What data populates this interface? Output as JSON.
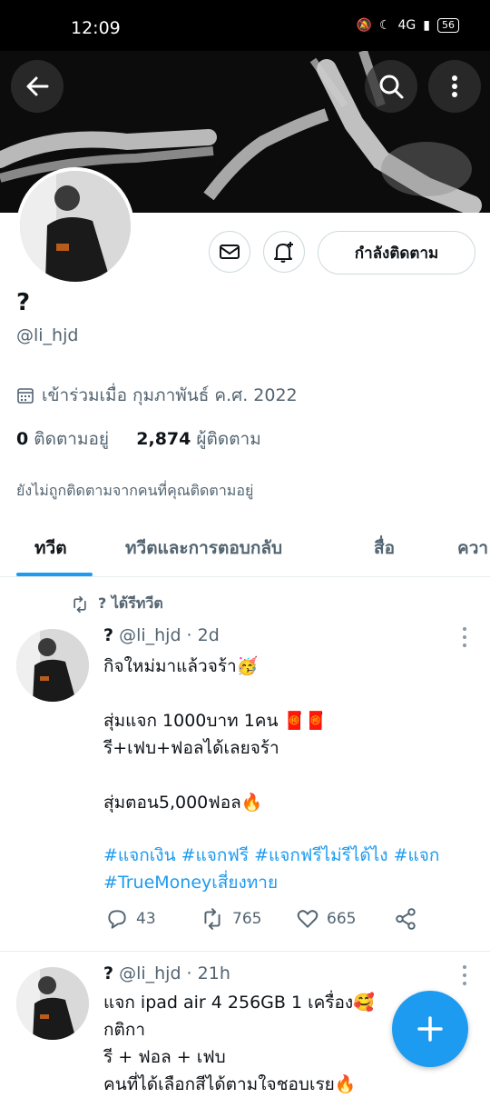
{
  "status_bar": {
    "time": "12:09",
    "signal": "4G",
    "battery": "56"
  },
  "profile": {
    "name": "?",
    "handle": "@li_hjd",
    "joined": "เข้าร่วมเมื่อ กุมภาพันธ์ ค.ศ. 2022",
    "following_count": "0",
    "following_label": "ติดตามอยู่",
    "followers_count": "2,874",
    "followers_label": "ผู้ติดตาม",
    "not_followed_note": "ยังไม่ถูกติดตามจากคนที่คุณติดตามอยู่",
    "follow_button": "กำลังติดตาม"
  },
  "tabs": [
    {
      "label": "ทวีต"
    },
    {
      "label": "ทวีตและการตอบกลับ"
    },
    {
      "label": "สื่อ"
    },
    {
      "label": "ควา"
    }
  ],
  "tweets": [
    {
      "retweet_label": "? ได้รีทวีต",
      "name": "?",
      "meta": "@li_hjd · 2d",
      "text": "กิจใหม่มาแล้วจร้า🥳\n\nสุ่มแจก 1000บาท 1คน 🧧🧧\nรี+เฟบ+ฟอลได้เลยจร้า\n\nสุ่มตอน5,000ฟอล🔥",
      "hashtags": "#แจกเงิน #แจกฟรี #แจกฟรีไม่รีได้ไง #แจก #TrueMoneyเสี่ยงทาย",
      "replies": "43",
      "retweets": "765",
      "likes": "665"
    },
    {
      "name": "?",
      "meta": "@li_hjd · 21h",
      "text": "แจก ipad air 4 256GB 1 เครื่อง🥰\nกติกา\n รี + ฟอล + เฟบ\nคนที่ได้เลือกสีได้ตามใจชอบเรย🔥"
    }
  ],
  "colors": {
    "accent": "#1d9bf0",
    "secondary_text": "#536471",
    "primary_text": "#0f1419"
  },
  "icons": [
    "back-arrow-icon",
    "search-icon",
    "more-vertical-icon",
    "mail-icon",
    "bell-plus-icon",
    "calendar-icon",
    "retweet-icon",
    "reply-icon",
    "like-icon",
    "share-icon",
    "compose-plus-icon"
  ]
}
